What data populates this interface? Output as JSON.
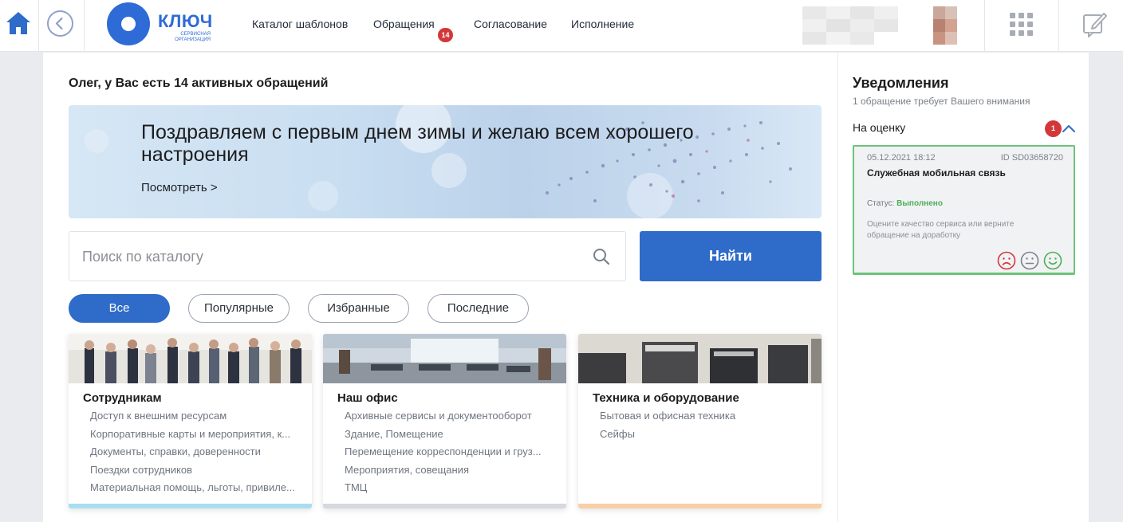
{
  "header": {
    "logo_title": "КЛЮЧ",
    "logo_subtitle": "СЕРВИСНАЯ ОРГАНИЗАЦИЯ",
    "nav": [
      {
        "label": "Каталог шаблонов"
      },
      {
        "label": "Обращения",
        "badge": "14"
      },
      {
        "label": "Согласование"
      },
      {
        "label": "Исполнение"
      }
    ],
    "icons": [
      "home-icon",
      "back-icon",
      "apps-grid-icon",
      "edit-note-icon"
    ]
  },
  "main": {
    "greeting": "Олег, у Вас есть 14 активных обращений",
    "banner": {
      "title": "Поздравляем с первым днем зимы и желаю всем хорошего настроения",
      "link": "Посмотреть >"
    },
    "search": {
      "placeholder": "Поиск по каталогу",
      "button": "Найти"
    },
    "filters": [
      "Все",
      "Популярные",
      "Избранные",
      "Последние"
    ],
    "active_filter": "Все",
    "cards": [
      {
        "title": "Сотрудникам",
        "items": [
          "Доступ к внешним ресурсам",
          "Корпоративные карты и мероприятия, к...",
          "Документы, справки, доверенности",
          "Поездки сотрудников",
          "Материальная помощь, льготы, привиле..."
        ],
        "accent": "#a9def0"
      },
      {
        "title": "Наш офис",
        "items": [
          "Архивные сервисы и документооборот",
          "Здание, Помещение",
          "Перемещение корреспонденции и груз...",
          "Мероприятия, совещания",
          "ТМЦ"
        ],
        "accent": "#d5d8de"
      },
      {
        "title": "Техника и оборудование",
        "items": [
          "Бытовая и офисная техника",
          "Сейфы"
        ],
        "accent": "#f9cfa7"
      }
    ]
  },
  "notifications": {
    "title": "Уведомления",
    "subtitle": "1 обращение требует Вашего внимания",
    "section": "На оценку",
    "section_count": "1",
    "ticket": {
      "date": "05.12.2021 18:12",
      "id": "ID SD03658720",
      "title": "Служебная мобильная связь",
      "status_label": "Статус:",
      "status_value": "Выполнено",
      "note": "Оцените качество сервиса или верните обращение на доработку",
      "ratings": [
        "sad-face-icon",
        "neutral-face-icon",
        "happy-face-icon"
      ]
    }
  },
  "colors": {
    "primary": "#2f6bc8",
    "badge": "#d2383a",
    "success": "#4cae5a",
    "background": "#e9ebef"
  }
}
